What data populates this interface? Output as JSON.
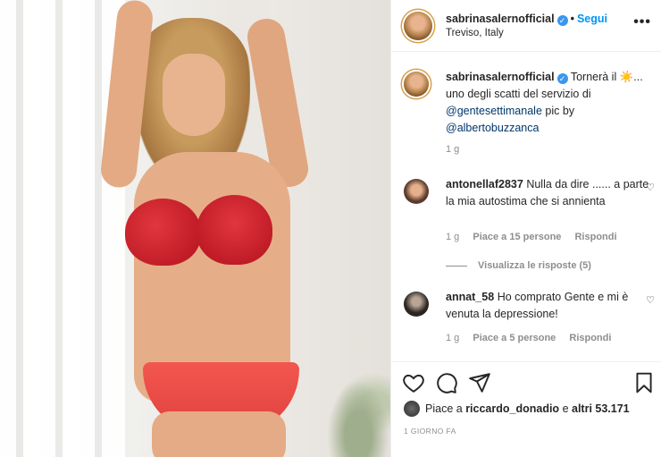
{
  "header": {
    "username": "sabrinasalernofficial",
    "follow_label": "Segui",
    "location": "Treviso, Italy",
    "more": "•••"
  },
  "caption": {
    "username": "sabrinasalernofficial",
    "text_1": "Tornerà il ☀️...",
    "text_2": "uno degli scatti del servizio di",
    "mention_1": "@gentesettimanale",
    "text_3": " pic by",
    "mention_2": "@albertobuzzanca",
    "time": "1 g"
  },
  "comments": [
    {
      "username": "antonellaf2837",
      "text": "Nulla da dire ...... a parte la mia autostima che si annienta",
      "time": "1 g",
      "likes": "Piace a 15 persone",
      "reply": "Rispondi",
      "view_replies": "Visualizza le risposte (5)"
    },
    {
      "username": "annat_58",
      "text": "Ho comprato Gente e mi è venuta la depressione!",
      "time": "1 g",
      "likes": "Piace a 5 persone",
      "reply": "Rispondi"
    }
  ],
  "likes_bar": {
    "prefix": "Piace a",
    "user": "riccardo_donadio",
    "middle": "e",
    "others": "altri 53.171"
  },
  "timestamp": "1 GIORNO FA",
  "colors": {
    "accent": "#0095f6",
    "verified": "#3897f0"
  }
}
